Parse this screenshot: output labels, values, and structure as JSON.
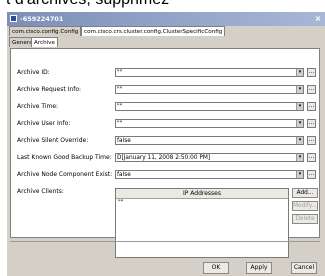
{
  "caption": "t d'archives, supprimez",
  "window": {
    "title": "-659224701",
    "close_glyph": "×"
  },
  "tabs": [
    {
      "label": "com.cisco.config.Config"
    },
    {
      "label": "com.cisco.crs.cluster.config.ClusterSpecificConfig"
    }
  ],
  "subtabs": [
    {
      "label": "General"
    },
    {
      "label": "Archive"
    }
  ],
  "fields": [
    {
      "label": "Archive ID:",
      "value": "\"\""
    },
    {
      "label": "Archive Request Info:",
      "value": "\"\""
    },
    {
      "label": "Archive Time:",
      "value": "\"\""
    },
    {
      "label": "Archive User Info:",
      "value": "\"\""
    },
    {
      "label": "Archive Silent Override:",
      "value": "false"
    },
    {
      "label": "Last Known Good Backup Time:",
      "value": "D[January 11, 2008 2:50:00 PM]"
    },
    {
      "label": "Archive Node Component Exist:",
      "value": "false"
    }
  ],
  "ellipsis_label": "...",
  "dropdown_glyph": "▾",
  "clients": {
    "label": "Archive Clients:",
    "column_header": "IP Addresses",
    "rows": [
      "\"\""
    ]
  },
  "side_buttons": {
    "add": "Add...",
    "modify": "Modify...",
    "delete": "Delete"
  },
  "buttons": {
    "ok": "OK",
    "apply": "Apply",
    "cancel": "Cancel"
  },
  "colors": {
    "window_bg": "#d4d0c8",
    "titlebar": "#7b8fb8"
  }
}
